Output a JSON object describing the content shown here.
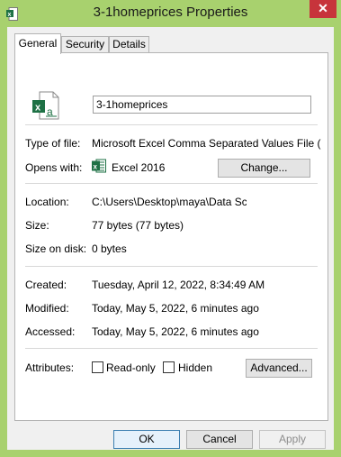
{
  "window": {
    "title": "3-1homeprices Properties",
    "close_glyph": "✕"
  },
  "tabs": [
    {
      "label": "General"
    },
    {
      "label": "Security"
    },
    {
      "label": "Details"
    }
  ],
  "file": {
    "icon": "excel-csv-file-icon",
    "name": "3-1homeprices"
  },
  "details": {
    "type_label": "Type of file:",
    "type_value": "Microsoft Excel Comma Separated Values File (.csv)",
    "opens_label": "Opens with:",
    "opens_value": "Excel 2016",
    "change_button": "Change...",
    "location_label": "Location:",
    "location_value": "C:\\Users\\Desktop\\maya\\Data Scie",
    "size_label": "Size:",
    "size_value": "77 bytes (77 bytes)",
    "size_disk_label": "Size on disk:",
    "size_disk_value": "0 bytes",
    "created_label": "Created:",
    "created_value": "Tuesday, April 12, 2022, 8:34:49 AM",
    "modified_label": "Modified:",
    "modified_value": "Today, May 5, 2022, 6 minutes ago",
    "accessed_label": "Accessed:",
    "accessed_value": "Today, May 5, 2022, 6 minutes ago",
    "attributes_label": "Attributes:",
    "readonly_label": "Read-only",
    "readonly_checked": false,
    "hidden_label": "Hidden",
    "hidden_checked": false,
    "advanced_button": "Advanced..."
  },
  "footer": {
    "ok": "OK",
    "cancel": "Cancel",
    "apply": "Apply"
  },
  "colors": {
    "frame": "#a8d16e",
    "close": "#c7343b",
    "excel_green": "#1e7145"
  }
}
